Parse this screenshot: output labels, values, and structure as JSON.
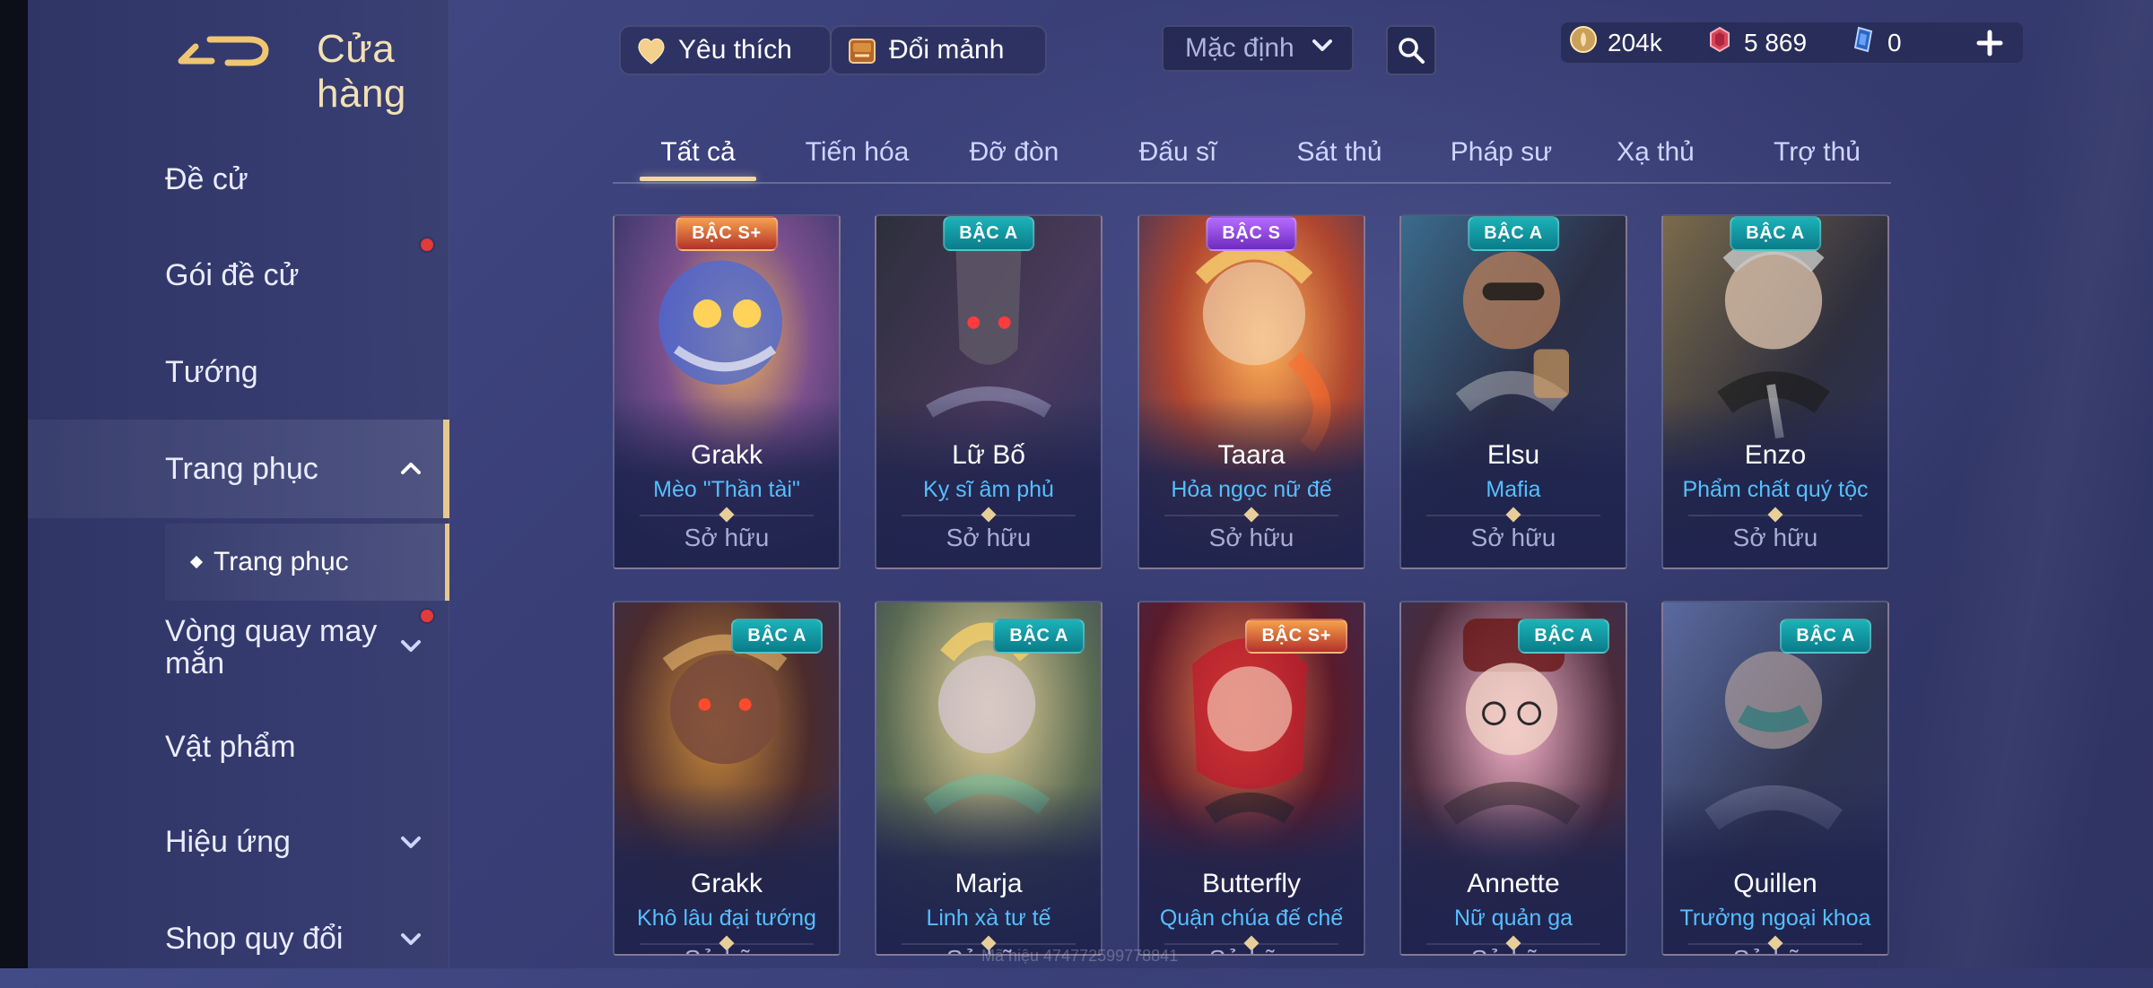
{
  "app": {
    "page_title": "Cửa hàng",
    "watermark": "Mã hiệu 474772599778841"
  },
  "topbar": {
    "favorite_label": "Yêu thích",
    "exchange_label": "Đổi mảnh",
    "sort_selected": "Mặc định",
    "currencies": {
      "gold": "204k",
      "vouchers": "5 869",
      "quan_huy": "0"
    }
  },
  "sidebar": {
    "items": [
      {
        "label": "Đề cử"
      },
      {
        "label": "Gói đề cử"
      },
      {
        "label": "Tướng"
      },
      {
        "label": "Trang phục"
      },
      {
        "label": "Vòng quay may mắn"
      },
      {
        "label": "Vật phẩm"
      },
      {
        "label": "Hiệu ứng"
      },
      {
        "label": "Shop quy đổi"
      }
    ],
    "sub_item": {
      "label": "Trang phục"
    }
  },
  "tabs": [
    {
      "label": "Tất cả"
    },
    {
      "label": "Tiến hóa"
    },
    {
      "label": "Đỡ đòn"
    },
    {
      "label": "Đấu sĩ"
    },
    {
      "label": "Sát thủ"
    },
    {
      "label": "Pháp sư"
    },
    {
      "label": "Xạ thủ"
    },
    {
      "label": "Trợ thủ"
    }
  ],
  "cards": [
    {
      "badge": "BẬC S+",
      "hero": "Grakk",
      "skin": "Mèo \"Thần tài\"",
      "status": "Sở hữu"
    },
    {
      "badge": "BẬC A",
      "hero": "Lữ Bố",
      "skin": "Kỵ sĩ âm phủ",
      "status": "Sở hữu"
    },
    {
      "badge": "BẬC S",
      "hero": "Taara",
      "skin": "Hỏa ngọc nữ đế",
      "status": "Sở hữu"
    },
    {
      "badge": "BẬC A",
      "hero": "Elsu",
      "skin": "Mafia",
      "status": "Sở hữu"
    },
    {
      "badge": "BẬC A",
      "hero": "Enzo",
      "skin": "Phẩm chất quý tộc",
      "status": "Sở hữu"
    },
    {
      "badge": "BẬC A",
      "hero": "Grakk",
      "skin": "Khô lâu đại tướng",
      "status": "Sở hữu"
    },
    {
      "badge": "BẬC A",
      "hero": "Marja",
      "skin": "Linh xà tư tế",
      "status": "Sở hữu"
    },
    {
      "badge": "BẬC S+",
      "hero": "Butterfly",
      "skin": "Quận chúa đế chế",
      "status": "Sở hữu"
    },
    {
      "badge": "BẬC A",
      "hero": "Annette",
      "skin": "Nữ quản ga",
      "status": "Sở hữu"
    },
    {
      "badge": "BẬC A",
      "hero": "Quillen",
      "skin": "Trưởng ngoại khoa",
      "status": "Sở hữu"
    }
  ]
}
